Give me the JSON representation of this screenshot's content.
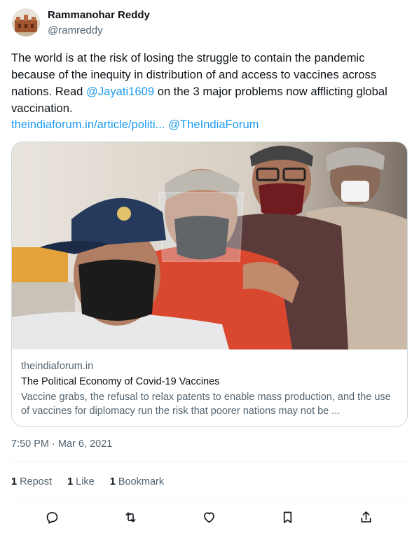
{
  "author": {
    "name": "Rammanohar Reddy",
    "handle": "@ramreddy",
    "avatar_icon": "fort-photo-avatar"
  },
  "tweet": {
    "text_before": "The world is at the risk of losing the struggle to contain the pandemic because of the inequity in distribution of and access to vaccines across nations. Read ",
    "mention": "@Jayati1609",
    "text_after": " on the 3 major problems now afflicting global vaccination.",
    "link": "theindiaforum.in/article/politi...",
    "mention2": "@TheIndiaForum"
  },
  "card": {
    "domain": "theindiaforum.in",
    "title": "The Political Economy of Covid-19 Vaccines",
    "description": "Vaccine grabs, the refusal to relax patents to enable mass production, and the use of vaccines for diplomacy run the risk that poorer nations may not be ..."
  },
  "timestamp": "7:50 PM · Mar 6, 2021",
  "stats": {
    "reposts_count": "1",
    "reposts_label": "Repost",
    "likes_count": "1",
    "likes_label": "Like",
    "bookmarks_count": "1",
    "bookmarks_label": "Bookmark"
  },
  "actions": [
    "reply-icon",
    "repost-icon",
    "like-icon",
    "bookmark-icon",
    "share-icon"
  ],
  "colors": {
    "text": "#0f1419",
    "secondary": "#536471",
    "link": "#1d9bf0",
    "border": "#cfd9de"
  }
}
